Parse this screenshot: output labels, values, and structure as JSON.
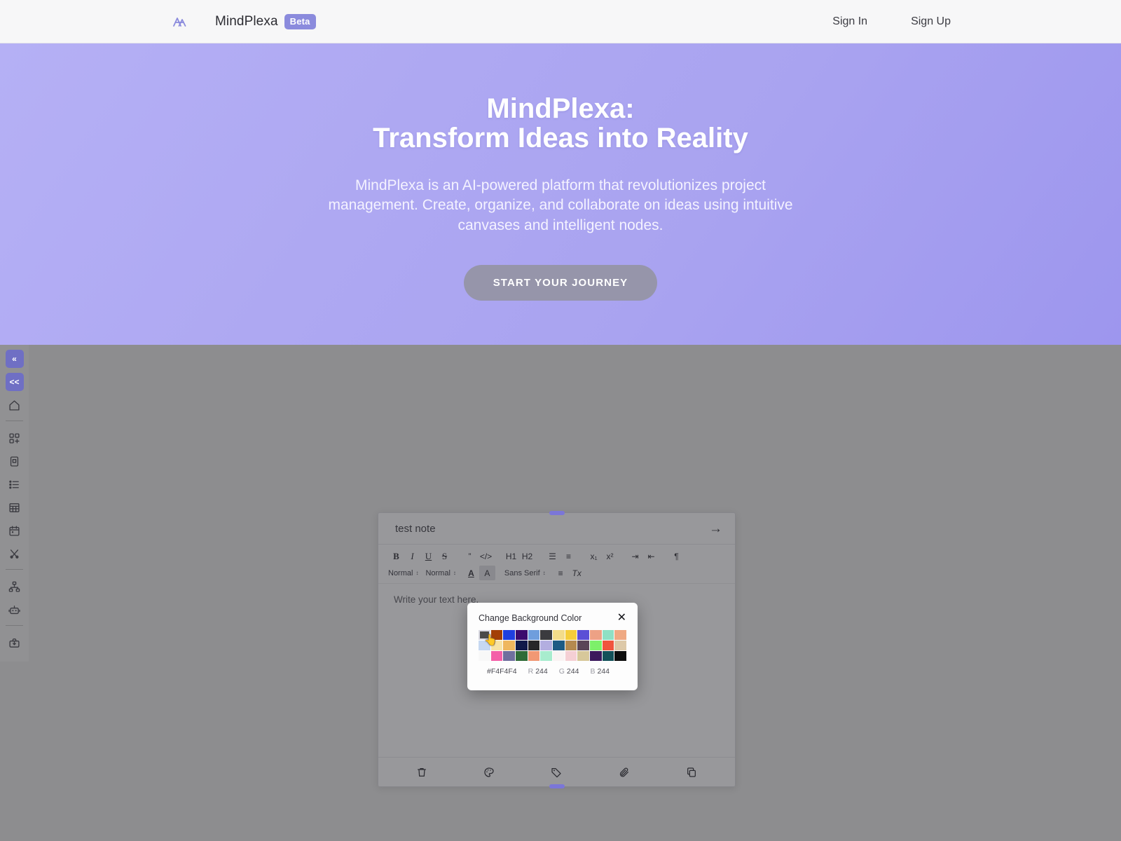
{
  "nav": {
    "logo_icon": "mindplexa-logo-icon",
    "brand": "MindPlexa",
    "badge": "Beta",
    "sign_in": "Sign In",
    "sign_up": "Sign Up"
  },
  "hero": {
    "title_line1": "MindPlexa:",
    "title_line2": "Transform Ideas into Reality",
    "subtitle": "MindPlexa is an AI-powered platform that revolutionizes project management. Create, organize, and collaborate on ideas using intuitive canvases and intelligent nodes.",
    "cta": "START YOUR JOURNEY",
    "gradient_from": "#b5b0f5",
    "gradient_to": "#9d96ee"
  },
  "sidebar": {
    "items": [
      {
        "name": "collapse-all-button",
        "icon": "double-chevron-left-icon",
        "glyph": "«",
        "accent": true
      },
      {
        "name": "collapse-panel-button",
        "icon": "double-angle-left-icon",
        "glyph": "<<",
        "accent": true
      },
      {
        "name": "home-button",
        "icon": "home-icon",
        "glyph": "",
        "accent": false
      },
      {
        "name": "divider-1",
        "icon": "divider",
        "glyph": "",
        "accent": false
      },
      {
        "name": "add-widget-button",
        "icon": "grid-plus-icon",
        "glyph": "",
        "accent": false
      },
      {
        "name": "note-button",
        "icon": "clipboard-icon",
        "glyph": "",
        "accent": false
      },
      {
        "name": "list-button",
        "icon": "list-icon",
        "glyph": "",
        "accent": false
      },
      {
        "name": "table-button",
        "icon": "table-icon",
        "glyph": "",
        "accent": false
      },
      {
        "name": "calendar-button",
        "icon": "calendar-icon",
        "glyph": "",
        "accent": false
      },
      {
        "name": "tools-button",
        "icon": "scissors-icon",
        "glyph": "",
        "accent": false
      },
      {
        "name": "divider-2",
        "icon": "divider",
        "glyph": "",
        "accent": false
      },
      {
        "name": "hierarchy-button",
        "icon": "org-chart-icon",
        "glyph": "",
        "accent": false
      },
      {
        "name": "ai-assistant-button",
        "icon": "robot-icon",
        "glyph": "",
        "accent": false
      },
      {
        "name": "divider-3",
        "icon": "divider",
        "glyph": "",
        "accent": false
      },
      {
        "name": "export-button",
        "icon": "briefcase-download-icon",
        "glyph": "",
        "accent": false
      }
    ]
  },
  "note": {
    "title": "test note",
    "expand_icon": "arrow-right-icon",
    "placeholder": "Write your text here.",
    "toolbar_row1": [
      {
        "label": "B",
        "name": "bold-button",
        "style": "bold"
      },
      {
        "label": "I",
        "name": "italic-button",
        "style": "italic"
      },
      {
        "label": "U",
        "name": "underline-button",
        "style": "underline"
      },
      {
        "label": "S",
        "name": "strikethrough-button",
        "style": "strike"
      },
      {
        "label": "”",
        "name": "blockquote-button",
        "style": "plain"
      },
      {
        "label": "</>",
        "name": "code-block-button",
        "style": "code"
      },
      {
        "label": "H1",
        "name": "heading-1-button",
        "style": "plain"
      },
      {
        "label": "H2",
        "name": "heading-2-button",
        "style": "plain"
      },
      {
        "label": "☰",
        "name": "ordered-list-button",
        "style": "plain"
      },
      {
        "label": "≡",
        "name": "bullet-list-button",
        "style": "plain"
      },
      {
        "label": "x₁",
        "name": "subscript-button",
        "style": "plain"
      },
      {
        "label": "x²",
        "name": "superscript-button",
        "style": "plain"
      },
      {
        "label": "⇥",
        "name": "indent-button",
        "style": "plain"
      },
      {
        "label": "⇤",
        "name": "outdent-button",
        "style": "plain"
      },
      {
        "label": "¶",
        "name": "text-direction-button",
        "style": "plain"
      }
    ],
    "toolbar_row2": {
      "size_select": "Normal",
      "block_select": "Normal",
      "font_color_icon": "text-color-a-icon",
      "highlight_icon": "highlight-color-a-icon",
      "font_select": "Sans Serif",
      "align_icon": "align-icon",
      "clear_format_icon": "clear-formatting-icon",
      "font_color_label": "A",
      "highlight_label": "A",
      "align_label": "≡",
      "clear_label": "Tx"
    },
    "footer": [
      {
        "name": "delete-note-button",
        "icon": "trash-icon"
      },
      {
        "name": "change-color-button",
        "icon": "palette-icon"
      },
      {
        "name": "tag-note-button",
        "icon": "tag-icon"
      },
      {
        "name": "attach-file-button",
        "icon": "paperclip-icon"
      },
      {
        "name": "duplicate-note-button",
        "icon": "copy-icon"
      }
    ]
  },
  "color_picker": {
    "title": "Change Background Color",
    "close_icon": "close-icon",
    "hex": "#F4F4F4",
    "r_label": "R",
    "r": "244",
    "g_label": "G",
    "g": "244",
    "b_label": "B",
    "b": "244",
    "selected_index": 0,
    "swatches": [
      "#4a4a4a",
      "#a33f06",
      "#1f3fe0",
      "#3b0a6e",
      "#6f9edd",
      "#3b3b3f",
      "#f3dc8a",
      "#f5cd3b",
      "#5b4fd6",
      "#eda185",
      "#8fe0c4",
      "#efa983",
      "#c6d8f2",
      "#f7e3a6",
      "#efb75e",
      "#101a4a",
      "#262628",
      "#b3aee0",
      "#1d5a84",
      "#b58a4f",
      "#5a4557",
      "#7df06a",
      "#f0553e",
      "#ddc9a8",
      "#f8f8f8",
      "#f45fa8",
      "#6f6f9e",
      "#2f6b37",
      "#f19874",
      "#a8ecce",
      "#faf3f3",
      "#f5cfd4",
      "#d7c89a",
      "#3c1a5c",
      "#135159",
      "#0d0d0d"
    ]
  }
}
